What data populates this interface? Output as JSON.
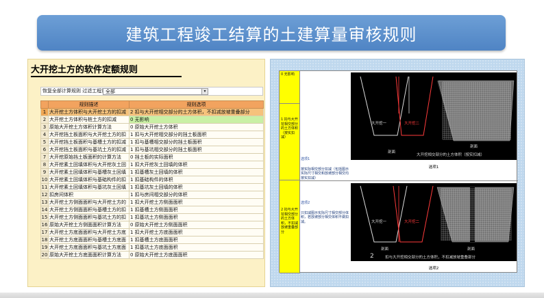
{
  "slide": {
    "title": "建筑工程竣工结算的土建算量审核规则"
  },
  "left_panel": {
    "title": "大开挖土方的软件定额规则",
    "filter": {
      "label": "恢复全部计算规则 过滤工程量:",
      "selected": "全部",
      "drop_icon": "▾"
    },
    "table": {
      "headers": [
        "",
        "规则描述",
        "规则选项"
      ],
      "rows": [
        {
          "num": "1",
          "desc": "大开挖土方体积与大开挖土方的扣减",
          "rule": "2  扣与大开挖相交部分的土方体积，不扣减放坡重叠部分"
        },
        {
          "num": "2",
          "desc": "大开挖土方体积与桩土方的扣减",
          "rule": "0  无影响"
        },
        {
          "num": "3",
          "desc": "原始大开挖土方体积计算方法",
          "rule": "0  原始大开挖土方体积"
        },
        {
          "num": "4",
          "desc": "大开挖挡土板面积与大开挖土方的扣",
          "rule": "1  扣与大开挖相交部分的挡土板面积"
        },
        {
          "num": "5",
          "desc": "大开挖挡土板面积与基槽土方的扣减",
          "rule": "1  扣与基槽相交部分的挡土板面积"
        },
        {
          "num": "6",
          "desc": "大开挖挡土板面积与基坑土方的扣减",
          "rule": "1  扣与基坑相交部分的挡土板面积"
        },
        {
          "num": "7",
          "desc": "大开挖原始挡土板面积的计算方法",
          "rule": "0  挡土板的实际面积"
        },
        {
          "num": "8",
          "desc": "大开挖素土回填体积与大开挖灰土回",
          "rule": "1  扣大开挖灰土回填的体积"
        },
        {
          "num": "9",
          "desc": "大开挖素土回填体积与基槽灰土回填",
          "rule": "1  扣基槽灰土回填的体积"
        },
        {
          "num": "10",
          "desc": "大开挖素土回填体积与基础构件的扣",
          "rule": "1  扣基础构件的体积"
        },
        {
          "num": "11",
          "desc": "大开挖素土回填体积与基坑灰土回填",
          "rule": "1  扣基坑灰土回填的体积"
        },
        {
          "num": "12",
          "desc": "扣房间体积",
          "rule": "1  扣与房间相交部分的体积"
        },
        {
          "num": "13",
          "desc": "大开挖土方侧面面积与大开挖土方的",
          "rule": "1  扣大开挖土方侧面面积"
        },
        {
          "num": "14",
          "desc": "大开挖土方侧面面积与基槽土方的扣",
          "rule": "1  扣基槽土方侧面面积"
        },
        {
          "num": "15",
          "desc": "大开挖土方侧面面积与基坑土方的扣",
          "rule": "1  扣基坑土方侧面面积"
        },
        {
          "num": "16",
          "desc": "原始大开挖土方侧面面积计算方法",
          "rule": "0  原始大开挖土方侧面面积"
        },
        {
          "num": "17",
          "desc": "大开挖土方底面面积与大开挖土方底",
          "rule": "1  扣大开挖土方底面面积"
        },
        {
          "num": "18",
          "desc": "大开挖土方底面面积与基槽土方底面",
          "rule": "1  扣基槽土方底面面积"
        },
        {
          "num": "19",
          "desc": "大开挖土方底面面积与基坑土方底面",
          "rule": "1  扣基坑土方底面面积"
        },
        {
          "num": "20",
          "desc": "原始大开挖土方底面面积计算方法",
          "rule": "0  原始大开挖土方底面面积"
        }
      ]
    }
  },
  "right_panel": {
    "options": [
      {
        "label": "0  无影响"
      },
      {
        "label": "1  扣与大开挖相交部分的土方体积（按实扣减）",
        "desc": "选项1",
        "desc_text": "按实际相交部分扣减（包括图示实际尺寸相交和放坡部分相交均按实扣减）",
        "fig_left": "大开挖一",
        "fig_right": "大开挖二",
        "fig_left_label": "剖面",
        "fig_right_label": "剖面",
        "fig_note": "大开挖相交部分的土方体积（按实扣减）",
        "caption": "选项1"
      },
      {
        "label": "2  扣与大开挖相交部分的土方体积，不扣减放坡重叠部分",
        "desc": "选项2",
        "desc_text": "只扣减图示实际尺寸相交部分体积，若放坡部分相交体积不做扣减。",
        "fig_left": "大开挖一",
        "fig_right": "大开挖二",
        "fig_left_label": "剖面",
        "fig_right_label": "剖面",
        "fig_num": "2",
        "fig_note": "扣与大开挖相交部分的土方体积，不扣减放坡重叠部分",
        "caption": "选项2"
      }
    ]
  }
}
